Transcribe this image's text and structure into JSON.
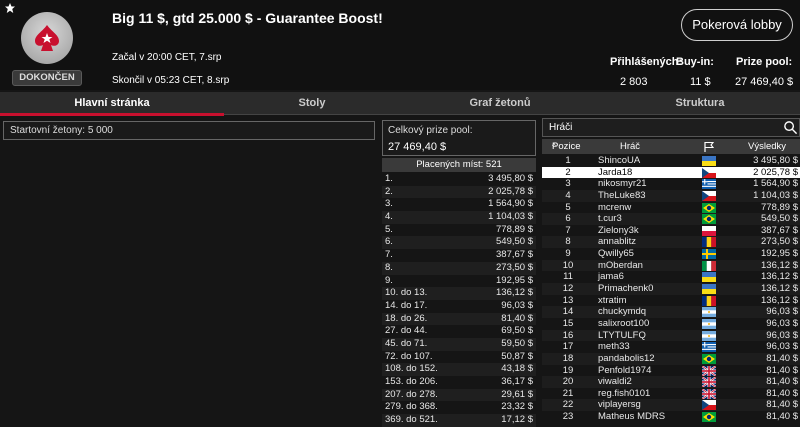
{
  "header": {
    "status": "DOKONČEN",
    "title": "Big 11 $, gtd 25.000 $ - Guarantee Boost!",
    "started": "Začal v 20:00 CET, 7.srp",
    "ended": "Skončil v 05:23 CET, 8.srp",
    "lobby_button": "Pokerová lobby",
    "stats": {
      "registered_label": "Přihlášených:",
      "registered_value": "2 803",
      "buyin_label": "Buy-in:",
      "buyin_value": "11 $",
      "prizepool_label": "Prize pool:",
      "prizepool_value": "27 469,40 $"
    }
  },
  "tabs": [
    "Hlavní stránka",
    "Stoly",
    "Graf žetonů",
    "Struktura"
  ],
  "left": {
    "starting_chips": "Startovní žetony:  5 000"
  },
  "middle": {
    "prize_label": "Celkový prize pool:",
    "prize_value": "27 469,40 $",
    "paid_places": "Placených míst: 521",
    "payouts": [
      {
        "place": "1.",
        "amount": "3 495,80 $"
      },
      {
        "place": "2.",
        "amount": "2 025,78 $"
      },
      {
        "place": "3.",
        "amount": "1 564,90 $"
      },
      {
        "place": "4.",
        "amount": "1 104,03 $"
      },
      {
        "place": "5.",
        "amount": "778,89 $"
      },
      {
        "place": "6.",
        "amount": "549,50 $"
      },
      {
        "place": "7.",
        "amount": "387,67 $"
      },
      {
        "place": "8.",
        "amount": "273,50 $"
      },
      {
        "place": "9.",
        "amount": "192,95 $"
      },
      {
        "place": "10. do 13.",
        "amount": "136,12 $"
      },
      {
        "place": "14. do 17.",
        "amount": "96,03 $"
      },
      {
        "place": "18. do 26.",
        "amount": "81,40 $"
      },
      {
        "place": "27. do 44.",
        "amount": "69,50 $"
      },
      {
        "place": "45. do 71.",
        "amount": "59,50 $"
      },
      {
        "place": "72. do 107.",
        "amount": "50,87 $"
      },
      {
        "place": "108. do 152.",
        "amount": "43,18 $"
      },
      {
        "place": "153. do 206.",
        "amount": "36,17 $"
      },
      {
        "place": "207. do 278.",
        "amount": "29,61 $"
      },
      {
        "place": "279. do 368.",
        "amount": "23,32 $"
      },
      {
        "place": "369. do 521.",
        "amount": "17,12 $"
      }
    ]
  },
  "right": {
    "search_label": "Hráči",
    "columns": {
      "position": "Pozice",
      "player": "Hráč",
      "results": "Výsledky"
    },
    "selected_index": 1,
    "players": [
      {
        "pos": "1",
        "name": "ShincoUA",
        "flag": "ua",
        "result": "3 495,80 $"
      },
      {
        "pos": "2",
        "name": "Jarda18",
        "flag": "cz",
        "result": "2 025,78 $"
      },
      {
        "pos": "3",
        "name": "nikosmyr21",
        "flag": "gr",
        "result": "1 564,90 $"
      },
      {
        "pos": "4",
        "name": "TheLuke83",
        "flag": "cz",
        "result": "1 104,03 $"
      },
      {
        "pos": "5",
        "name": "mcrenw",
        "flag": "br",
        "result": "778,89 $"
      },
      {
        "pos": "6",
        "name": "t.cur3",
        "flag": "br",
        "result": "549,50 $"
      },
      {
        "pos": "7",
        "name": "Zielony3k",
        "flag": "pl",
        "result": "387,67 $"
      },
      {
        "pos": "8",
        "name": "annablitz",
        "flag": "ro",
        "result": "273,50 $"
      },
      {
        "pos": "9",
        "name": "Qwilly65",
        "flag": "se",
        "result": "192,95 $"
      },
      {
        "pos": "10",
        "name": "mOberdan",
        "flag": "it",
        "result": "136,12 $"
      },
      {
        "pos": "11",
        "name": "jama6",
        "flag": "ua",
        "result": "136,12 $"
      },
      {
        "pos": "12",
        "name": "Primachenk0",
        "flag": "ua",
        "result": "136,12 $"
      },
      {
        "pos": "13",
        "name": "xtratim",
        "flag": "ro",
        "result": "136,12 $"
      },
      {
        "pos": "14",
        "name": "chuckymdq",
        "flag": "ar",
        "result": "96,03 $"
      },
      {
        "pos": "15",
        "name": "salixroot100",
        "flag": "ar",
        "result": "96,03 $"
      },
      {
        "pos": "16",
        "name": "LTYTULFQ",
        "flag": "ar",
        "result": "96,03 $"
      },
      {
        "pos": "17",
        "name": "meth33",
        "flag": "gr",
        "result": "96,03 $"
      },
      {
        "pos": "18",
        "name": "pandabolis12",
        "flag": "br",
        "result": "81,40 $"
      },
      {
        "pos": "19",
        "name": "Penfold1974",
        "flag": "gb",
        "result": "81,40 $"
      },
      {
        "pos": "20",
        "name": "viwaldi2",
        "flag": "gb",
        "result": "81,40 $"
      },
      {
        "pos": "21",
        "name": "reg.fish0101",
        "flag": "gb",
        "result": "81,40 $"
      },
      {
        "pos": "22",
        "name": "viplayersg",
        "flag": "cz",
        "result": "81,40 $"
      },
      {
        "pos": "23",
        "name": "Matheus MDRS",
        "flag": "br",
        "result": "81,40 $"
      }
    ]
  },
  "colors": {
    "accent": "#c8102e",
    "background": "#151515"
  }
}
